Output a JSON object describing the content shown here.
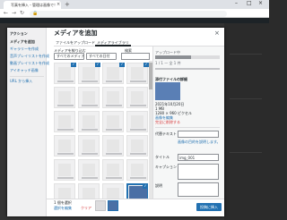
{
  "browser": {
    "tab_title": "写真を挿入・管理は画像で！ ブ…",
    "tab_close": "×",
    "new_tab": "+",
    "minimize": "–",
    "maximize": "□",
    "close": "×",
    "back": "←",
    "forward": "→",
    "reload": "↻",
    "lock_icon": "lock-icon"
  },
  "menu": {
    "title": "アクション",
    "items": [
      {
        "label": "メディアを追加",
        "active": true
      },
      {
        "label": "ギャラリーを作成",
        "active": false
      },
      {
        "label": "音声プレイリストを作成",
        "active": false
      },
      {
        "label": "動画プレイリストを作成",
        "active": false
      },
      {
        "label": "アイキャッチ画像",
        "active": false
      }
    ],
    "url_insert": "URL から挿入"
  },
  "modal": {
    "title": "メディアを追加",
    "close": "×",
    "tabs": [
      "ファイルをアップロード",
      "メディアライブラリ"
    ],
    "filter_label": "メディアを絞り込む",
    "filter_type": "すべてのメディア",
    "filter_date": "すべての日付",
    "search_label": "検索"
  },
  "sidebar": {
    "upload_state": "アップロード中",
    "upload_count": "1 / 1 — 全 1 件",
    "attachment_title": "添付ファイルの詳細",
    "meta": [
      "2021年10月20日",
      "1 MB",
      "1280 × 960 ピクセル"
    ],
    "edit_link": "画像を編集",
    "delete_link": "完全に削除する",
    "alt_label": "代替テキスト",
    "alt_note": "画像の目的を説明します。",
    "title_label": "タイトル",
    "title_value": "img_001",
    "caption_label": "キャプション",
    "desc_label": "説明"
  },
  "footer": {
    "selected_label": "1 個を選択",
    "edit_selection": "選択を編集",
    "clear": "クリア",
    "insert_button": "投稿に挿入"
  }
}
